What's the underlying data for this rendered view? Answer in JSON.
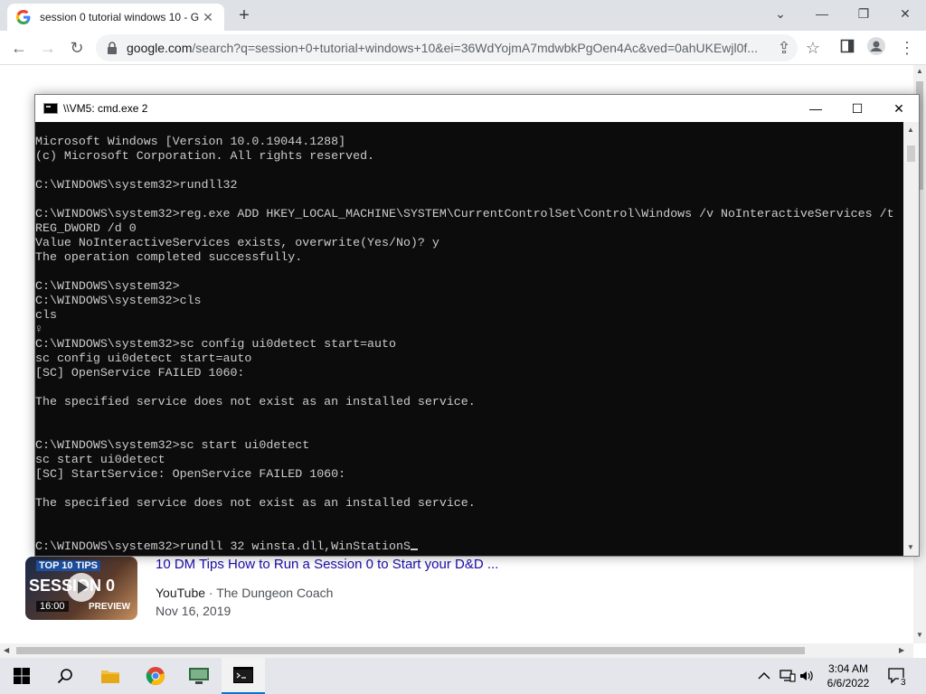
{
  "browser": {
    "tab_title": "session 0 tutorial windows 10 - G",
    "tab_close": "✕",
    "new_tab": "+",
    "url_host": "google.com",
    "url_rest": "/search?q=session+0+tutorial+windows+10&ei=36WdYojmA7mdwbkPgOen4Ac&ved=0ahUKEwjl0f...",
    "win_buttons": {
      "dropdown": "⌄",
      "minimize": "—",
      "restore": "❐",
      "close": "✕"
    },
    "nav": {
      "back": "←",
      "forward": "→",
      "reload": "↻",
      "share": "⇪",
      "bookmark": "☆",
      "menu": "⋮"
    }
  },
  "result": {
    "title": "10 DM Tips How to Run a Session 0 to Start your D&D ...",
    "source": "YouTube",
    "separator": " · ",
    "channel": "The Dungeon Coach",
    "date": "Nov 16, 2019",
    "thumb_top": "TOP 10 TIPS",
    "thumb_main": "SESSION 0",
    "duration": "16:00",
    "preview": "PREVIEW"
  },
  "cmd": {
    "title": "\\\\VM5: cmd.exe 2",
    "btn_min": "—",
    "btn_max": "☐",
    "btn_close": "✕",
    "lines": [
      "Microsoft Windows [Version 10.0.19044.1288]",
      "(c) Microsoft Corporation. All rights reserved.",
      "",
      "C:\\WINDOWS\\system32>rundll32",
      "",
      "C:\\WINDOWS\\system32>reg.exe ADD HKEY_LOCAL_MACHINE\\SYSTEM\\CurrentControlSet\\Control\\Windows /v NoInteractiveServices /t",
      "REG_DWORD /d 0",
      "Value NoInteractiveServices exists, overwrite(Yes/No)? y",
      "The operation completed successfully.",
      "",
      "C:\\WINDOWS\\system32>",
      "C:\\WINDOWS\\system32>cls",
      "cls",
      "♀",
      "C:\\WINDOWS\\system32>sc config ui0detect start=auto",
      "sc config ui0detect start=auto",
      "[SC] OpenService FAILED 1060:",
      "",
      "The specified service does not exist as an installed service.",
      "",
      "",
      "C:\\WINDOWS\\system32>sc start ui0detect",
      "sc start ui0detect",
      "[SC] StartService: OpenService FAILED 1060:",
      "",
      "The specified service does not exist as an installed service.",
      "",
      "",
      "C:\\WINDOWS\\system32>rundll 32 winsta.dll,WinStationS"
    ]
  },
  "taskbar": {
    "clock_time": "3:04 AM",
    "clock_date": "6/6/2022",
    "notifications": "3",
    "tray_chevron": "^",
    "speaker": "🔈"
  }
}
